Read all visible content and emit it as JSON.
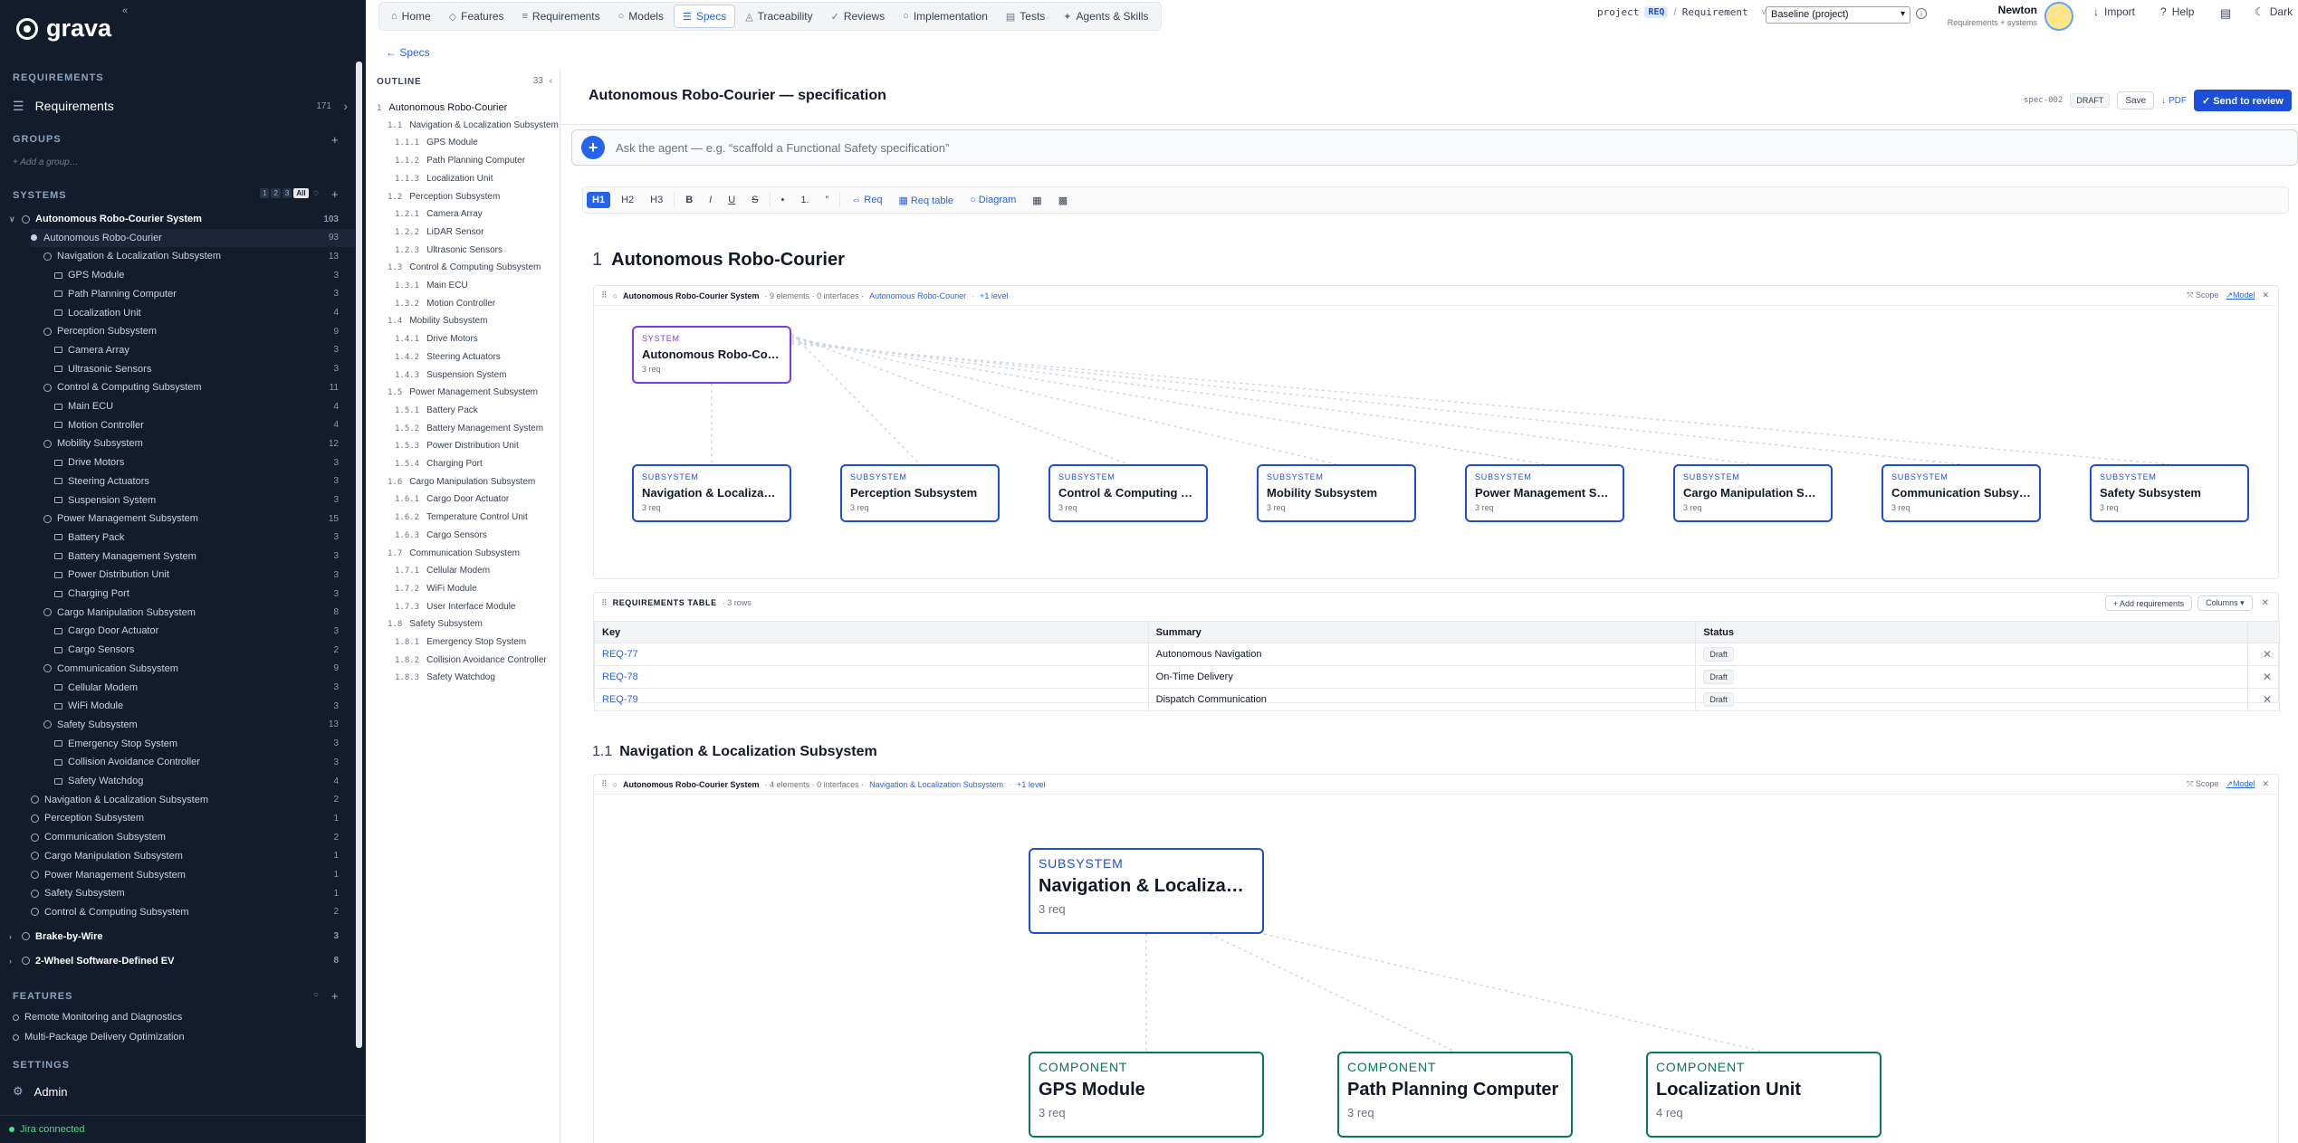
{
  "brand": {
    "name": "grava",
    "collapse_icon": "«"
  },
  "sidebar": {
    "requirements_title": "REQUIREMENTS",
    "requirements_item": {
      "label": "Requirements",
      "count": "171"
    },
    "groups_title": "GROUPS",
    "add_group": "+ Add a group…",
    "systems_title": "SYSTEMS",
    "level_buttons": [
      "1",
      "2",
      "3",
      "All"
    ],
    "tree": [
      {
        "label": "Autonomous Robo-Courier System",
        "count": "103",
        "lvl": 0,
        "kind": "root"
      },
      {
        "label": "Autonomous Robo-Courier",
        "count": "93",
        "lvl": 1,
        "kind": "dot"
      },
      {
        "label": "Navigation & Localization Subsystem",
        "count": "13",
        "lvl": 2,
        "kind": "ring"
      },
      {
        "label": "GPS Module",
        "count": "3",
        "lvl": 3,
        "kind": "sq"
      },
      {
        "label": "Path Planning Computer",
        "count": "3",
        "lvl": 3,
        "kind": "sq"
      },
      {
        "label": "Localization Unit",
        "count": "4",
        "lvl": 3,
        "kind": "sq"
      },
      {
        "label": "Perception Subsystem",
        "count": "9",
        "lvl": 2,
        "kind": "ring"
      },
      {
        "label": "Camera Array",
        "count": "3",
        "lvl": 3,
        "kind": "sq"
      },
      {
        "label": "Ultrasonic Sensors",
        "count": "3",
        "lvl": 3,
        "kind": "sq"
      },
      {
        "label": "Control & Computing Subsystem",
        "count": "11",
        "lvl": 2,
        "kind": "ring"
      },
      {
        "label": "Main ECU",
        "count": "4",
        "lvl": 3,
        "kind": "sq"
      },
      {
        "label": "Motion Controller",
        "count": "4",
        "lvl": 3,
        "kind": "sq"
      },
      {
        "label": "Mobility Subsystem",
        "count": "12",
        "lvl": 2,
        "kind": "ring"
      },
      {
        "label": "Drive Motors",
        "count": "3",
        "lvl": 3,
        "kind": "sq"
      },
      {
        "label": "Steering Actuators",
        "count": "3",
        "lvl": 3,
        "kind": "sq"
      },
      {
        "label": "Suspension System",
        "count": "3",
        "lvl": 3,
        "kind": "sq"
      },
      {
        "label": "Power Management Subsystem",
        "count": "15",
        "lvl": 2,
        "kind": "ring"
      },
      {
        "label": "Battery Pack",
        "count": "3",
        "lvl": 3,
        "kind": "sq"
      },
      {
        "label": "Battery Management System",
        "count": "3",
        "lvl": 3,
        "kind": "sq"
      },
      {
        "label": "Power Distribution Unit",
        "count": "3",
        "lvl": 3,
        "kind": "sq"
      },
      {
        "label": "Charging Port",
        "count": "3",
        "lvl": 3,
        "kind": "sq"
      },
      {
        "label": "Cargo Manipulation Subsystem",
        "count": "8",
        "lvl": 2,
        "kind": "ring"
      },
      {
        "label": "Cargo Door Actuator",
        "count": "3",
        "lvl": 3,
        "kind": "sq"
      },
      {
        "label": "Cargo Sensors",
        "count": "2",
        "lvl": 3,
        "kind": "sq"
      },
      {
        "label": "Communication Subsystem",
        "count": "9",
        "lvl": 2,
        "kind": "ring"
      },
      {
        "label": "Cellular Modem",
        "count": "3",
        "lvl": 3,
        "kind": "sq"
      },
      {
        "label": "WiFi Module",
        "count": "3",
        "lvl": 3,
        "kind": "sq"
      },
      {
        "label": "Safety Subsystem",
        "count": "13",
        "lvl": 2,
        "kind": "ring"
      },
      {
        "label": "Emergency Stop System",
        "count": "3",
        "lvl": 3,
        "kind": "sq"
      },
      {
        "label": "Collision Avoidance Controller",
        "count": "3",
        "lvl": 3,
        "kind": "sq"
      },
      {
        "label": "Safety Watchdog",
        "count": "4",
        "lvl": 3,
        "kind": "sq"
      },
      {
        "label": "Navigation & Localization Subsystem",
        "count": "2",
        "lvl": 1,
        "kind": "ring"
      },
      {
        "label": "Perception Subsystem",
        "count": "1",
        "lvl": 1,
        "kind": "ring"
      },
      {
        "label": "Communication Subsystem",
        "count": "2",
        "lvl": 1,
        "kind": "ring"
      },
      {
        "label": "Cargo Manipulation Subsystem",
        "count": "1",
        "lvl": 1,
        "kind": "ring"
      },
      {
        "label": "Power Management Subsystem",
        "count": "1",
        "lvl": 1,
        "kind": "ring"
      },
      {
        "label": "Safety Subsystem",
        "count": "1",
        "lvl": 1,
        "kind": "ring"
      },
      {
        "label": "Control & Computing Subsystem",
        "count": "2",
        "lvl": 1,
        "kind": "ring"
      }
    ],
    "other_systems": [
      {
        "label": "Brake-by-Wire",
        "count": "3"
      },
      {
        "label": "2-Wheel Software-Defined EV",
        "count": "8"
      }
    ],
    "features_title": "FEATURES",
    "features": [
      "Remote Monitoring and Diagnostics",
      "Multi-Package Delivery Optimization"
    ],
    "settings_title": "SETTINGS",
    "admin": "Admin",
    "status": "Jira connected"
  },
  "topnav": [
    {
      "label": "Home",
      "icon": "⌂"
    },
    {
      "label": "Features",
      "icon": "◇"
    },
    {
      "label": "Requirements",
      "icon": "≡"
    },
    {
      "label": "Models",
      "icon": "○"
    },
    {
      "label": "Specs",
      "icon": "☰",
      "active": true
    },
    {
      "label": "Traceability",
      "icon": "◬"
    },
    {
      "label": "Reviews",
      "icon": "✓"
    },
    {
      "label": "Implementation",
      "icon": "○"
    },
    {
      "label": "Tests",
      "icon": "▤"
    },
    {
      "label": "Agents & Skills",
      "icon": "✦"
    }
  ],
  "topright": {
    "project_label": "project",
    "project_key": "REQ",
    "breadcrumb": "Requirement",
    "baseline": "Baseline (project)",
    "user_name": "Newton",
    "user_role": "Requirements + systems",
    "import": "Import",
    "help": "Help",
    "theme": "Dark"
  },
  "spec": {
    "back": "← Specs",
    "title": "Autonomous Robo-Courier — specification",
    "id": "spec-002",
    "status": "DRAFT",
    "save": "Save",
    "pdf": "PDF",
    "send": "✓ Send to review",
    "agent_placeholder": "Ask the agent — e.g. “scaffold a Functional Safety specification”",
    "toolbar": [
      "H1",
      "H2",
      "H3",
      "B",
      "I",
      "U",
      "S",
      "•",
      "1.",
      "”",
      "Req",
      "Req table",
      "Diagram"
    ]
  },
  "outline": {
    "title": "OUTLINE",
    "count": "33",
    "items": [
      {
        "n": "1",
        "t": "Autonomous Robo-Courier",
        "lvl": 0
      },
      {
        "n": "1.1",
        "t": "Navigation & Localization Subsystem",
        "lvl": 1
      },
      {
        "n": "1.1.1",
        "t": "GPS Module",
        "lvl": 2
      },
      {
        "n": "1.1.2",
        "t": "Path Planning Computer",
        "lvl": 2
      },
      {
        "n": "1.1.3",
        "t": "Localization Unit",
        "lvl": 2
      },
      {
        "n": "1.2",
        "t": "Perception Subsystem",
        "lvl": 1
      },
      {
        "n": "1.2.1",
        "t": "Camera Array",
        "lvl": 2
      },
      {
        "n": "1.2.2",
        "t": "LiDAR Sensor",
        "lvl": 2
      },
      {
        "n": "1.2.3",
        "t": "Ultrasonic Sensors",
        "lvl": 2
      },
      {
        "n": "1.3",
        "t": "Control & Computing Subsystem",
        "lvl": 1
      },
      {
        "n": "1.3.1",
        "t": "Main ECU",
        "lvl": 2
      },
      {
        "n": "1.3.2",
        "t": "Motion Controller",
        "lvl": 2
      },
      {
        "n": "1.4",
        "t": "Mobility Subsystem",
        "lvl": 1
      },
      {
        "n": "1.4.1",
        "t": "Drive Motors",
        "lvl": 2
      },
      {
        "n": "1.4.2",
        "t": "Steering Actuators",
        "lvl": 2
      },
      {
        "n": "1.4.3",
        "t": "Suspension System",
        "lvl": 2
      },
      {
        "n": "1.5",
        "t": "Power Management Subsystem",
        "lvl": 1
      },
      {
        "n": "1.5.1",
        "t": "Battery Pack",
        "lvl": 2
      },
      {
        "n": "1.5.2",
        "t": "Battery Management System",
        "lvl": 2
      },
      {
        "n": "1.5.3",
        "t": "Power Distribution Unit",
        "lvl": 2
      },
      {
        "n": "1.5.4",
        "t": "Charging Port",
        "lvl": 2
      },
      {
        "n": "1.6",
        "t": "Cargo Manipulation Subsystem",
        "lvl": 1
      },
      {
        "n": "1.6.1",
        "t": "Cargo Door Actuator",
        "lvl": 2
      },
      {
        "n": "1.6.2",
        "t": "Temperature Control Unit",
        "lvl": 2
      },
      {
        "n": "1.6.3",
        "t": "Cargo Sensors",
        "lvl": 2
      },
      {
        "n": "1.7",
        "t": "Communication Subsystem",
        "lvl": 1
      },
      {
        "n": "1.7.1",
        "t": "Cellular Modem",
        "lvl": 2
      },
      {
        "n": "1.7.2",
        "t": "WiFi Module",
        "lvl": 2
      },
      {
        "n": "1.7.3",
        "t": "User Interface Module",
        "lvl": 2
      },
      {
        "n": "1.8",
        "t": "Safety Subsystem",
        "lvl": 1
      },
      {
        "n": "1.8.1",
        "t": "Emergency Stop System",
        "lvl": 2
      },
      {
        "n": "1.8.2",
        "t": "Collision Avoidance Controller",
        "lvl": 2
      },
      {
        "n": "1.8.3",
        "t": "Safety Watchdog",
        "lvl": 2
      }
    ]
  },
  "section1": {
    "num": "1",
    "title": "Autonomous Robo-Courier",
    "diagram": {
      "system": "Autonomous Robo-Courier System",
      "meta": "· 9 elements · 0 interfaces ·",
      "scope_link": "Autonomous Robo-Courier",
      "level": "+1 level",
      "scope": "Scope",
      "model": "Model",
      "root": {
        "kind": "SYSTEM",
        "title": "Autonomous Robo-Couri…",
        "req": "3 req"
      },
      "children": [
        {
          "kind": "SUBSYSTEM",
          "title": "Navigation & Localiza…",
          "req": "3 req"
        },
        {
          "kind": "SUBSYSTEM",
          "title": "Perception Subsystem",
          "req": "3 req"
        },
        {
          "kind": "SUBSYSTEM",
          "title": "Control & Computing S…",
          "req": "3 req"
        },
        {
          "kind": "SUBSYSTEM",
          "title": "Mobility Subsystem",
          "req": "3 req"
        },
        {
          "kind": "SUBSYSTEM",
          "title": "Power Management Subs…",
          "req": "3 req"
        },
        {
          "kind": "SUBSYSTEM",
          "title": "Cargo Manipulation Su…",
          "req": "3 req"
        },
        {
          "kind": "SUBSYSTEM",
          "title": "Communication Subsyst…",
          "req": "3 req"
        },
        {
          "kind": "SUBSYSTEM",
          "title": "Safety Subsystem",
          "req": "3 req"
        }
      ]
    },
    "table": {
      "title": "REQUIREMENTS TABLE",
      "rows_label": "· 3 rows",
      "add": "+ Add requirements",
      "columns": "Columns ▾",
      "headers": [
        "Key",
        "Summary",
        "Status"
      ],
      "rows": [
        {
          "key": "REQ-77",
          "summary": "Autonomous Navigation",
          "status": "Draft"
        },
        {
          "key": "REQ-78",
          "summary": "On-Time Delivery",
          "status": "Draft"
        },
        {
          "key": "REQ-79",
          "summary": "Dispatch Communication",
          "status": "Draft"
        }
      ]
    }
  },
  "section11": {
    "num": "1.1",
    "title": "Navigation & Localization Subsystem",
    "diagram": {
      "system": "Autonomous Robo-Courier System",
      "meta": "· 4 elements · 0 interfaces ·",
      "scope_link": "Navigation & Localization Subsystem",
      "level": "+1 level",
      "scope": "Scope",
      "model": "Model",
      "root": {
        "kind": "SUBSYSTEM",
        "title": "Navigation & Localiza…",
        "req": "3 req"
      },
      "children": [
        {
          "kind": "COMPONENT",
          "title": "GPS Module",
          "req": "3 req"
        },
        {
          "kind": "COMPONENT",
          "title": "Path Planning Computer",
          "req": "3 req"
        },
        {
          "kind": "COMPONENT",
          "title": "Localization Unit",
          "req": "4 req"
        }
      ]
    }
  },
  "colors": {
    "primary": "#1d4ed8",
    "system": "#7c3aed",
    "component": "#047857",
    "sidebar": "#121c2c"
  }
}
